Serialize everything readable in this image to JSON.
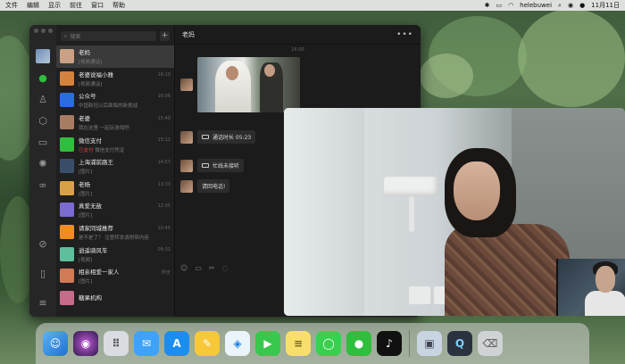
{
  "menubar": {
    "menus": [
      "文件",
      "编辑",
      "显示",
      "前往",
      "窗口",
      "帮助"
    ],
    "user": "helebuwei",
    "date": "11月11日"
  },
  "wechat": {
    "search_placeholder": "搜索",
    "chat_title": "老妈",
    "chat_time": "16:00",
    "conversations": [
      {
        "name": "老妈",
        "preview": "[视频通话]",
        "time": "",
        "color": "#caa184"
      },
      {
        "name": "老婆说福小雅",
        "preview": "[视频通话]",
        "time": "16:10",
        "color": "#d4823e"
      },
      {
        "name": "公众号",
        "preview": "中国新冠以后面临的新挑战",
        "time": "16:06",
        "color": "#2b6ce0"
      },
      {
        "name": "老婆",
        "preview": "我在这里 一起玩游戏吧",
        "time": "15:40",
        "color": "#a87b63"
      },
      {
        "name": "微信支付",
        "preview": "微信支付凭证",
        "time": "15:12",
        "color": "#2fbe3d",
        "highlight": "已支付"
      },
      {
        "name": "上海浦前路王",
        "preview": "[图片]",
        "time": "14:57",
        "color": "#3a4e6a"
      },
      {
        "name": "老杨",
        "preview": "[图片]",
        "time": "13:33",
        "color": "#d9a146"
      },
      {
        "name": "真爱无敌",
        "preview": "[图片]",
        "time": "12:05",
        "color": "#7a6bd0"
      },
      {
        "name": "请家同城推荐",
        "preview": "是不是了？ 注意转发请附带内容",
        "time": "10:45",
        "color": "#f28c1e"
      },
      {
        "name": "逍遥骑风车",
        "preview": "[视频]",
        "time": "09:31",
        "color": "#5fbf9c"
      },
      {
        "name": "相亲相爱一家人",
        "preview": "[图片]",
        "time": "昨天",
        "color": "#d17a55"
      },
      {
        "name": "糖果机构",
        "preview": "",
        "time": "",
        "color": "#c66c8b"
      }
    ],
    "messages": [
      {
        "type": "call",
        "text": "通话时长 05:23"
      },
      {
        "type": "call",
        "text": "忙线未接听"
      },
      {
        "type": "text",
        "text": "请回电话!"
      }
    ]
  },
  "icons": {
    "rail": [
      "chat-icon",
      "contacts-icon",
      "box-icon",
      "folder-icon",
      "moments-icon",
      "channels-icon",
      "mini-program-icon",
      "phone-icon",
      "menu-icon"
    ],
    "dock": [
      "finder",
      "siri",
      "launchpad",
      "mail",
      "app-store",
      "notes-pen",
      "safari",
      "facetime",
      "notes",
      "messages",
      "wechat",
      "tiktok",
      "preview",
      "quicktime",
      "trash"
    ]
  }
}
